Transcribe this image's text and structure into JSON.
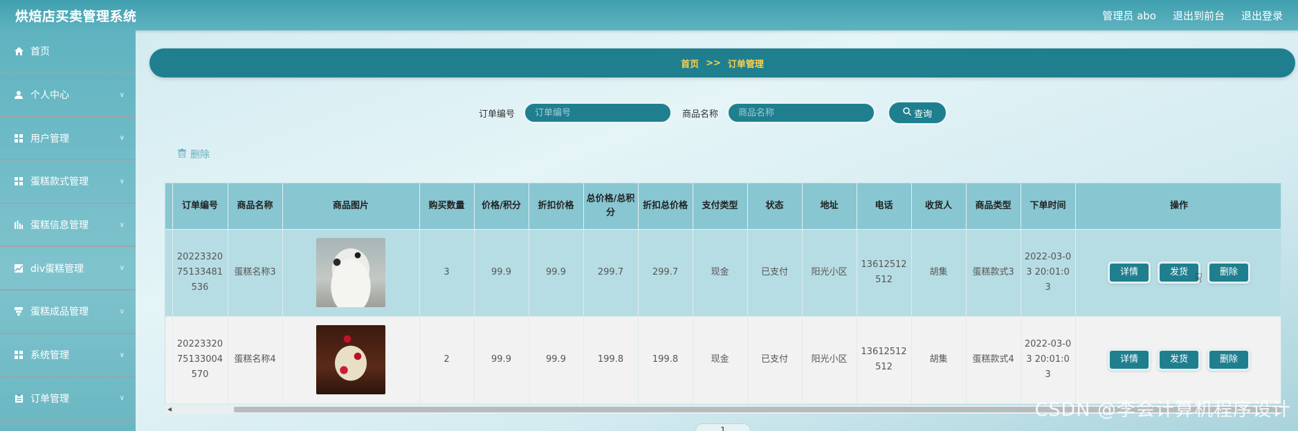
{
  "app": {
    "title": "烘焙店买卖管理系统",
    "admin_label": "管理员 abo",
    "back_to_front": "退出到前台",
    "logout": "退出登录"
  },
  "sidebar": {
    "items": [
      {
        "label": "首页",
        "icon": "home-icon"
      },
      {
        "label": "个人中心",
        "icon": "user-icon"
      },
      {
        "label": "用户管理",
        "icon": "grid-icon"
      },
      {
        "label": "蛋糕款式管理",
        "icon": "grid-icon"
      },
      {
        "label": "蛋糕信息管理",
        "icon": "bar-chart-icon"
      },
      {
        "label": "div蛋糕管理",
        "icon": "line-chart-icon"
      },
      {
        "label": "蛋糕成品管理",
        "icon": "layers-icon"
      },
      {
        "label": "系统管理",
        "icon": "grid-icon"
      },
      {
        "label": "订单管理",
        "icon": "clipboard-icon"
      }
    ]
  },
  "breadcrumb": {
    "home": "首页",
    "sep": ">>",
    "current": "订单管理"
  },
  "search": {
    "order_no_label": "订单编号",
    "order_no_placeholder": "订单编号",
    "product_label": "商品名称",
    "product_placeholder": "商品名称",
    "query_label": "查询"
  },
  "bulk_delete_label": "删除",
  "table": {
    "headers": [
      "订单编号",
      "商品名称",
      "商品图片",
      "购买数量",
      "价格/积分",
      "折扣价格",
      "总价格/总积分",
      "折扣总价格",
      "支付类型",
      "状态",
      "地址",
      "电话",
      "收货人",
      "商品类型",
      "下单时间",
      "操作"
    ],
    "rows": [
      {
        "order_no": "202233207513348153 6",
        "order_no_display": "2022332075133481536",
        "product": "蛋糕名称3",
        "qty": "3",
        "price": "99.9",
        "discount_price": "99.9",
        "total": "299.7",
        "discount_total": "299.7",
        "pay_type": "现金",
        "status": "已支付",
        "address": "阳光小区",
        "phone": "13612512512",
        "receiver": "胡集",
        "type": "蛋糕款式3",
        "time": "2022-03-03 20:01:03"
      },
      {
        "order_no_display": "2022332075133004570",
        "product": "蛋糕名称4",
        "qty": "2",
        "price": "99.9",
        "discount_price": "99.9",
        "total": "199.8",
        "discount_total": "199.8",
        "pay_type": "现金",
        "status": "已支付",
        "address": "阳光小区",
        "phone": "13612512512",
        "receiver": "胡集",
        "type": "蛋糕款式4",
        "time": "2022-03-03 20:01:03"
      }
    ],
    "actions": {
      "detail": "详情",
      "ship": "发货",
      "delete": "删除"
    }
  },
  "pager": {
    "current": "1"
  },
  "watermark": "CSDN @李会计算机程序设计",
  "colors": {
    "primary": "#1f7f8f",
    "accent_text": "#ffd24a",
    "sidebar": "#6ab7c2"
  }
}
